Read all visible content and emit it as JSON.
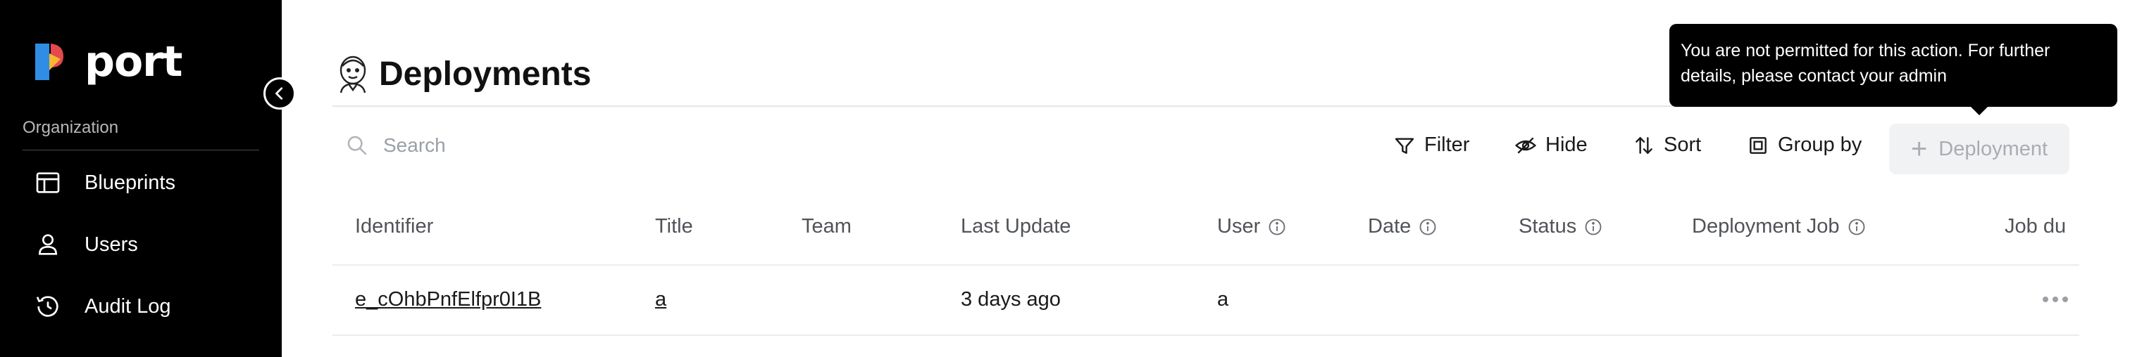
{
  "sidebar": {
    "logo_text": "port",
    "section_label": "Organization",
    "items": [
      {
        "label": "Blueprints",
        "icon": "table-layout-icon"
      },
      {
        "label": "Users",
        "icon": "user-icon"
      },
      {
        "label": "Audit Log",
        "icon": "history-icon"
      }
    ]
  },
  "page": {
    "title": "Deployments",
    "title_icon": "jenkins-butler-icon"
  },
  "search": {
    "placeholder": "Search"
  },
  "toolbar": {
    "filter_label": "Filter",
    "hide_label": "Hide",
    "sort_label": "Sort",
    "group_by_label": "Group by",
    "add_label": "Deployment"
  },
  "tooltip": {
    "text": "You are not permitted for this action. For further details, please contact your admin"
  },
  "table": {
    "columns": [
      "Identifier",
      "Title",
      "Team",
      "Last Update",
      "User",
      "Date",
      "Status",
      "Deployment Job",
      "Job du"
    ],
    "rows": [
      {
        "identifier": "e_cOhbPnfElfpr0I1B",
        "title": "a",
        "team": "",
        "last_update": "3 days ago",
        "user": "a",
        "date": "",
        "status": "",
        "deployment_job": ""
      }
    ]
  },
  "colors": {
    "sidebar_bg": "#000000",
    "disabled_button_bg": "#f1f2f4",
    "disabled_text": "#a9acb2",
    "logo_blue": "#2f8de4",
    "logo_red": "#e5484d",
    "logo_yellow": "#f5b82e"
  }
}
